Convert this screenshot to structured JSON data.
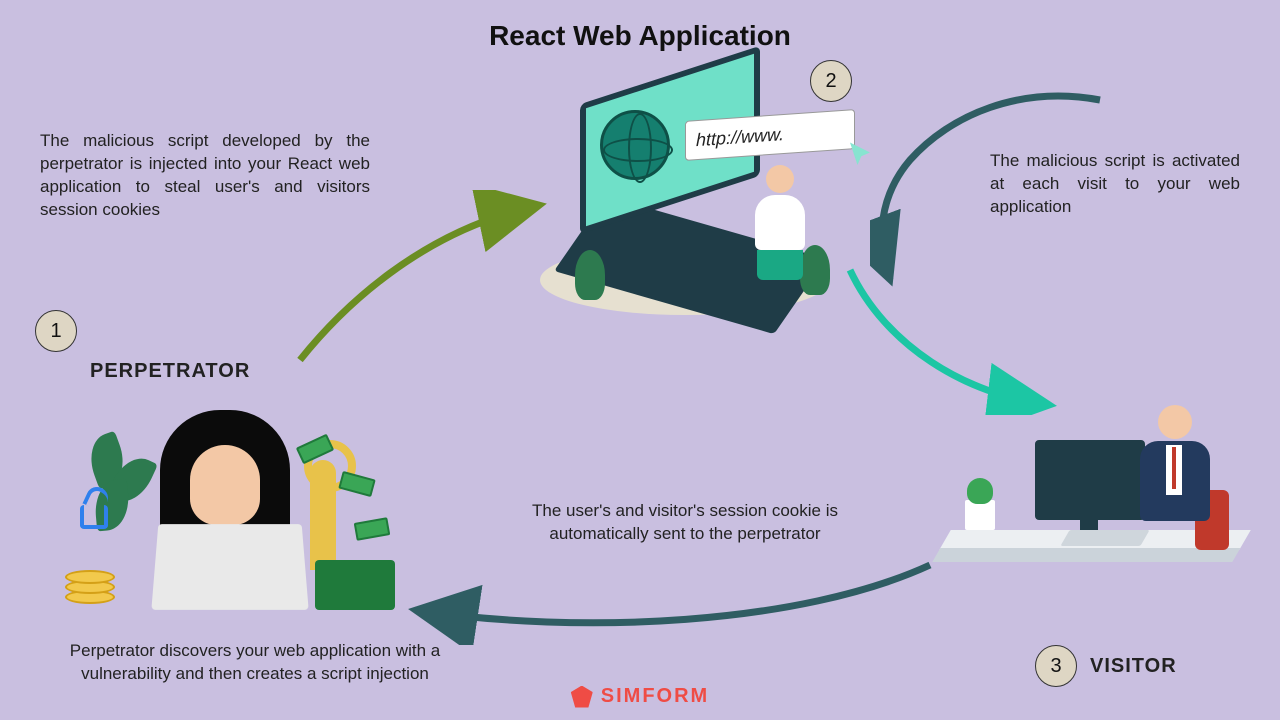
{
  "title": "React Web Application",
  "steps": {
    "one": {
      "num": "1",
      "label": "PERPETRATOR"
    },
    "two": {
      "num": "2"
    },
    "three": {
      "num": "3",
      "label": "VISITOR"
    }
  },
  "descriptions": {
    "inject": "The malicious script developed by the perpetrator is injected into your React web application to steal user's and visitors session cookies",
    "activate": "The malicious script is activated at each visit to your web application",
    "send": "The user's and visitor's session cookie is automatically sent to the perpetrator",
    "discover": "Perpetrator discovers your web application with a vulnerability and then creates a script injection"
  },
  "urlbar": "http://www.",
  "logo": "SIMFORM",
  "colors": {
    "arrow_green": "#6b8e23",
    "arrow_teal_dark": "#2f5d63",
    "arrow_teal_bright": "#1cc6a4",
    "accent": "#ef4c45"
  }
}
